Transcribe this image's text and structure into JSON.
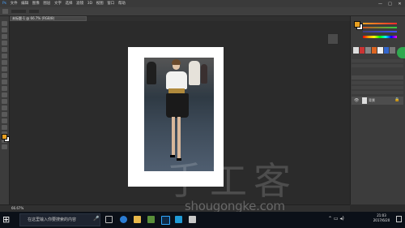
{
  "menu": {
    "items": [
      "文件",
      "编辑",
      "图像",
      "图层",
      "文字",
      "选择",
      "滤镜",
      "3D",
      "视图",
      "窗口",
      "帮助"
    ]
  },
  "window_controls": [
    "—",
    "□",
    "✕"
  ],
  "document_tab": "未标题-1 @ 66.7% (RGB/8)",
  "status_bar": {
    "zoom": "66.67%"
  },
  "layers": {
    "layer_name": "背景"
  },
  "taskbar": {
    "search_placeholder": "在这里输入你要搜索的内容",
    "clock_time": "21:03",
    "clock_date": "2017/6/20"
  },
  "watermark": {
    "text": "手工客",
    "url": "shougongke.com"
  },
  "icons": [
    "windows-start-icon",
    "microphone-icon",
    "edge-icon",
    "folder-icon",
    "photoshop-icon",
    "eye-icon",
    "lock-icon"
  ],
  "colors": {
    "foreground": "#e8a020",
    "background": "#ffffff",
    "accent_green": "#2fa84f"
  }
}
